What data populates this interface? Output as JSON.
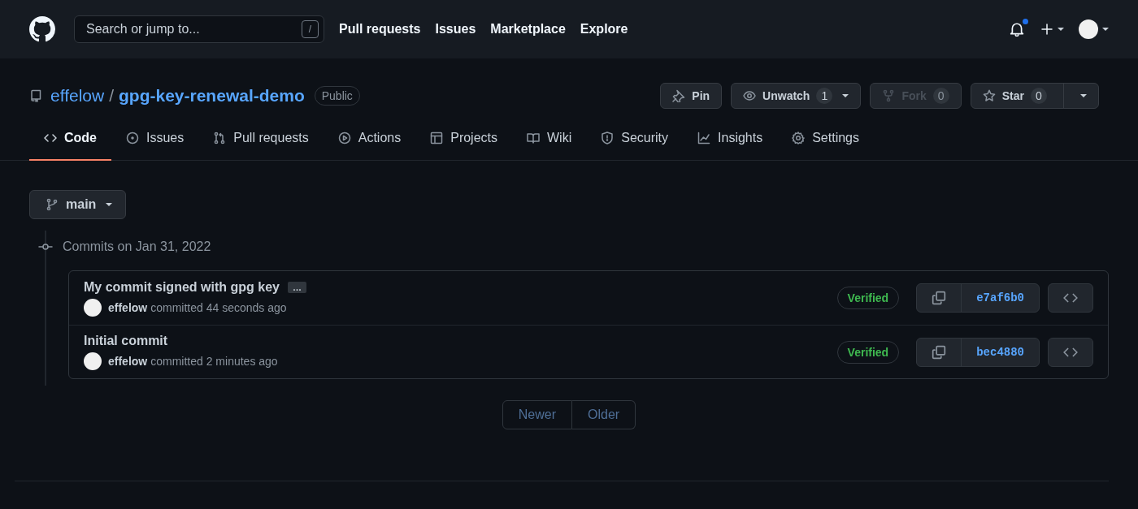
{
  "header": {
    "search": {
      "placeholder": "Search or jump to...",
      "shortcut": "/"
    },
    "nav": [
      "Pull requests",
      "Issues",
      "Marketplace",
      "Explore"
    ],
    "notifications_unread": true
  },
  "repo": {
    "owner": "effelow",
    "separator": "/",
    "name": "gpg-key-renewal-demo",
    "visibility": "Public"
  },
  "actions": [
    {
      "label": "Pin",
      "disabled": false
    },
    {
      "label": "Unwatch",
      "count": "1",
      "dropdown": true,
      "disabled": false
    },
    {
      "label": "Fork",
      "count": "0",
      "disabled": true
    },
    {
      "label": "Star",
      "count": "0",
      "split_dropdown": true,
      "disabled": false
    }
  ],
  "tabs": [
    {
      "label": "Code",
      "selected": true
    },
    {
      "label": "Issues",
      "selected": false
    },
    {
      "label": "Pull requests",
      "selected": false
    },
    {
      "label": "Actions",
      "selected": false
    },
    {
      "label": "Projects",
      "selected": false
    },
    {
      "label": "Wiki",
      "selected": false
    },
    {
      "label": "Security",
      "selected": false
    },
    {
      "label": "Insights",
      "selected": false
    },
    {
      "label": "Settings",
      "selected": false
    }
  ],
  "branch": "main",
  "commit_group": {
    "heading": "Commits on Jan 31, 2022",
    "commits": [
      {
        "title": "My commit signed with gpg key",
        "expander": "…",
        "author": "effelow",
        "when": "committed 44 seconds ago",
        "badge": "Verified",
        "sha": "e7af6b0"
      },
      {
        "title": "Initial commit",
        "author": "effelow",
        "when": "committed 2 minutes ago",
        "badge": "Verified",
        "sha": "bec4880"
      }
    ]
  },
  "pagination": [
    "Newer",
    "Older"
  ]
}
